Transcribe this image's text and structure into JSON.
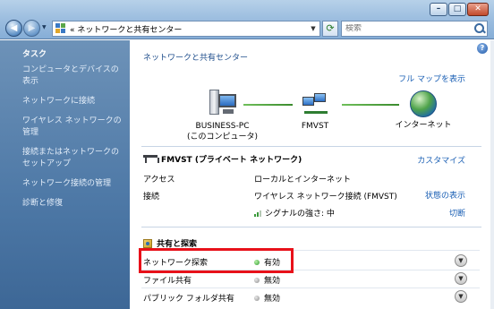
{
  "window": {
    "address": "«  ネットワークと共有センター",
    "search_placeholder": "検索",
    "minimize": "–",
    "maximize": "□",
    "close": "✕"
  },
  "nav": {
    "back": "◀",
    "forward": "▶"
  },
  "sidebar": {
    "heading": "タスク",
    "items": [
      "コンピュータとデバイスの表示",
      "ネットワークに接続",
      "ワイヤレス ネットワークの管理",
      "接続またはネットワークのセットアップ",
      "ネットワーク接続の管理",
      "診断と修復"
    ]
  },
  "main": {
    "help": "?",
    "title": "ネットワークと共有センター",
    "full_map": "フル マップを表示",
    "nodes": [
      {
        "name": "BUSINESS-PC",
        "sub": "(このコンピュータ)"
      },
      {
        "name": "FMVST",
        "sub": ""
      },
      {
        "name": "インターネット",
        "sub": ""
      }
    ],
    "network": {
      "title": "FMVST (プライベート ネットワーク)",
      "customize": "カスタマイズ",
      "rows": [
        {
          "label": "アクセス",
          "value": "ローカルとインターネット",
          "link": ""
        },
        {
          "label": "接続",
          "value": "ワイヤレス ネットワーク接続 (FMVST)",
          "link": "状態の表示"
        },
        {
          "label": "",
          "value": "シグナルの強さ: 中",
          "link": "切断"
        }
      ]
    },
    "sharing": {
      "title": "共有と探索",
      "items": [
        {
          "label": "ネットワーク探索",
          "status": "有効",
          "state": "on"
        },
        {
          "label": "ファイル共有",
          "status": "無効",
          "state": "off"
        },
        {
          "label": "パブリック フォルダ共有",
          "status": "無効",
          "state": "off"
        }
      ]
    },
    "colors": {
      "link": "#1a5fb4",
      "highlight": "#e8111a",
      "sidebar": "#4d78a6"
    }
  }
}
